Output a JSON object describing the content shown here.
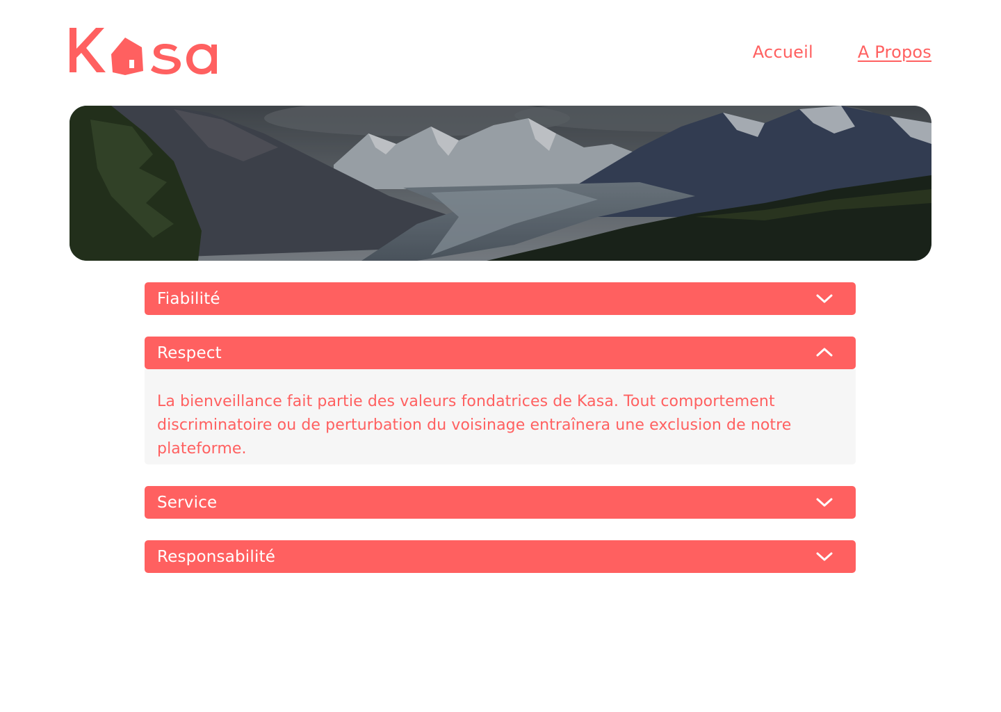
{
  "brand": {
    "logo_text": "Kasa",
    "color": "#FF6060"
  },
  "nav": {
    "items": [
      {
        "label": "Accueil",
        "active": false
      },
      {
        "label": "A Propos",
        "active": true
      }
    ]
  },
  "banner": {
    "image": "mountain-valley-landscape"
  },
  "collapses": [
    {
      "title": "Fiabilité",
      "open": false,
      "icon": "chevron-down-icon"
    },
    {
      "title": "Respect",
      "open": true,
      "icon": "chevron-up-icon",
      "content": "La bienveillance fait partie des valeurs fondatrices de Kasa. Tout comportement discriminatoire ou de perturbation du voisinage entraînera une exclusion de notre plateforme."
    },
    {
      "title": "Service",
      "open": false,
      "icon": "chevron-down-icon"
    },
    {
      "title": "Responsabilité",
      "open": false,
      "icon": "chevron-down-icon"
    }
  ],
  "colors": {
    "accent": "#FF6060",
    "panel_bg": "#F6F6F6",
    "text_on_accent": "#FFFFFF"
  }
}
